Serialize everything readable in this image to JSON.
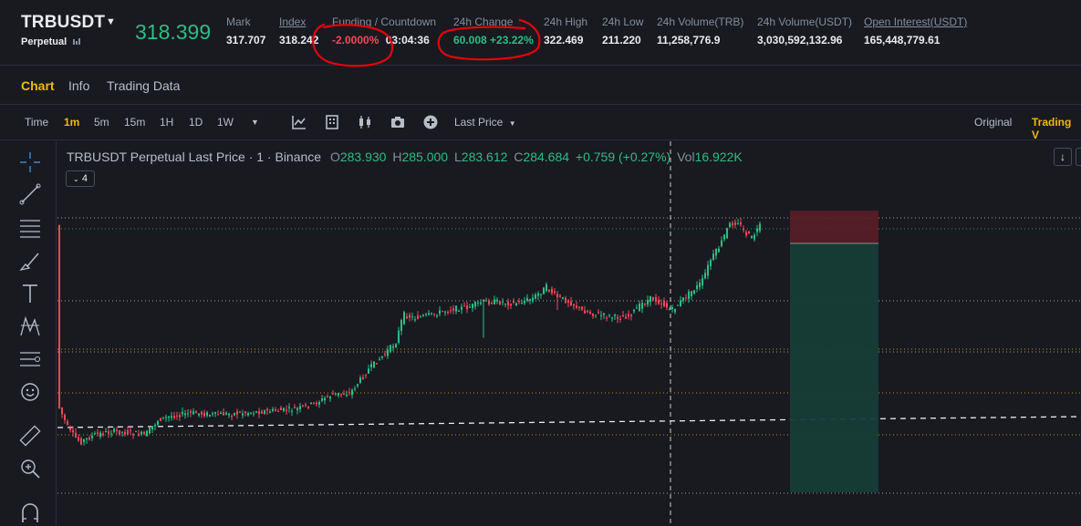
{
  "ticker": {
    "symbol": "TRBUSDT",
    "contract_type": "Perpetual",
    "last_price": "318.399",
    "stats": [
      {
        "label": "Mark",
        "value": "317.707"
      },
      {
        "label": "Index",
        "value": "318.242"
      },
      {
        "label": "Funding / Countdown",
        "funding": "-2.0000%",
        "countdown": "03:04:36"
      },
      {
        "label": "24h Change",
        "value": "60.008 +23.22%"
      },
      {
        "label": "24h High",
        "value": "322.469"
      },
      {
        "label": "24h Low",
        "value": "211.220"
      },
      {
        "label": "24h Volume(TRB)",
        "value": "11,258,776.9"
      },
      {
        "label": "24h Volume(USDT)",
        "value": "3,030,592,132.96"
      },
      {
        "label": "Open Interest(USDT)",
        "value": "165,448,779.61"
      }
    ]
  },
  "tabs": [
    "Chart",
    "Info",
    "Trading Data"
  ],
  "toolbar": {
    "time_label": "Time",
    "intervals": [
      "1m",
      "5m",
      "15m",
      "1H",
      "1D",
      "1W"
    ],
    "active_interval": "1m",
    "price_type": "Last Price",
    "view_original": "Original",
    "view_tradingview": "Trading V"
  },
  "legend": {
    "title": "TRBUSDT Perpetual Last Price · 1 · Binance",
    "open_label": "O",
    "open": "283.930",
    "high_label": "H",
    "high": "285.000",
    "low_label": "L",
    "low": "283.612",
    "close_label": "C",
    "close": "284.684",
    "change": "+0.759 (+0.27%)",
    "vol_label": "Vol",
    "vol": "16.922K",
    "indicator_count": "4"
  },
  "colors": {
    "background": "#181a20",
    "up": "#2ebd85",
    "down": "#f6465d",
    "accent": "#f0b90b",
    "annotation": "#e8000d"
  },
  "icons": [
    "chevron-down-icon",
    "indicator-icon",
    "template-icon",
    "candle-style-icon",
    "camera-icon",
    "plus-circle-icon",
    "crosshair-icon",
    "trend-line-icon",
    "fib-icon",
    "brush-icon",
    "text-icon",
    "pattern-icon",
    "prediction-icon",
    "emoji-icon",
    "ruler-icon",
    "zoom-icon",
    "magnet-icon",
    "arrow-down-icon"
  ]
}
